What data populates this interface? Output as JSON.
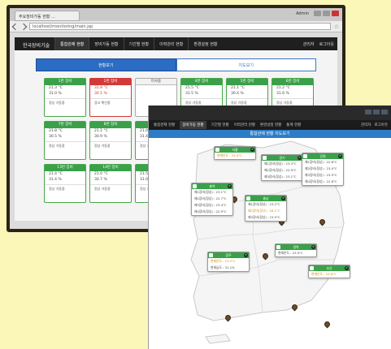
{
  "back_screen": {
    "browser": {
      "tab_title": "주요장비가동 현황 …",
      "url": "localhost/monitoring/main.jsp",
      "window_label": "Admin"
    },
    "navbar": {
      "brand": "한국장비기술",
      "items": [
        "통합관제 현황",
        "장비가동 현황",
        "기간별 현황",
        "이력관리 현황",
        "환경설정 현황"
      ],
      "active_index": 0,
      "right_items": [
        "관리자",
        "로그아웃"
      ]
    },
    "switch": {
      "active": "현황보기",
      "inactive": "지도보기"
    },
    "cards": [
      {
        "title": "1번 장비",
        "l1": "21.3 °C",
        "l2": "31.0 %",
        "footer": "정상 가동중",
        "status": "normal"
      },
      {
        "title": "2번 장비",
        "l1": "31.8 °C",
        "l2": "30.1 %",
        "footer": "경고 확인중",
        "status": "alert"
      },
      {
        "title": "미사용",
        "l1": "",
        "l2": "",
        "footer": "",
        "status": "blank"
      },
      {
        "title": "4번 장비",
        "l1": "21.5 °C",
        "l2": "31.5 %",
        "footer": "정상 가동중",
        "status": "normal"
      },
      {
        "title": "5번 장비",
        "l1": "21.1 °C",
        "l2": "30.4 %",
        "footer": "정상 가동중",
        "status": "normal"
      },
      {
        "title": "6번 장비",
        "l1": "21.2 °C",
        "l2": "31.6 %",
        "footer": "정상 가동중",
        "status": "normal"
      },
      {
        "title": "7번 장비",
        "l1": "21.8 °C",
        "l2": "30.5 %",
        "footer": "정상 가동중",
        "status": "normal"
      },
      {
        "title": "8번 장비",
        "l1": "21.1 °C",
        "l2": "30.9 %",
        "footer": "정상 가동중",
        "status": "normal"
      },
      {
        "title": "9번 장비",
        "l1": "21.0 °C",
        "l2": "31.4 %",
        "footer": "정상 가동중",
        "status": "normal"
      },
      {
        "title": "10번 장비",
        "l1": "21.4 °C",
        "l2": "31.1 %",
        "footer": "정상 가동중",
        "status": "normal"
      },
      {
        "title": "11번 장비",
        "l1": "21.6 °C",
        "l2": "30.8 %",
        "footer": "정상 가동중",
        "status": "normal"
      },
      {
        "title": "12번 장비",
        "l1": "21.3 °C",
        "l2": "31.2 %",
        "footer": "정상 가동중",
        "status": "normal"
      },
      {
        "title": "13번 장비",
        "l1": "21.4 °C",
        "l2": "31.4 %",
        "footer": "정상 가동중",
        "status": "normal"
      },
      {
        "title": "14번 장비",
        "l1": "21.0 °C",
        "l2": "30.7 %",
        "footer": "정상 가동중",
        "status": "normal"
      },
      {
        "title": "15번 장비",
        "l1": "21.5 °C",
        "l2": "31.0 %",
        "footer": "정상 가동중",
        "status": "normal"
      },
      {
        "title": "16번 장비",
        "l1": "21.2 °C",
        "l2": "31.3 %",
        "footer": "정상 가동중",
        "status": "normal"
      }
    ]
  },
  "front_screen": {
    "navbar": {
      "items": [
        "통합관제 현황",
        "장비가동 현황",
        "기간별 현황",
        "이력관리 현황",
        "환경설정 현황",
        "통계 현황"
      ],
      "active_index": 1,
      "right_items": [
        "관리자",
        "로그아웃"
      ]
    },
    "title": "통합관제 현황 지도보기",
    "map_cards": [
      {
        "title": "서울",
        "lines": [
          "현재온도 : 23.4°C"
        ],
        "warn": [
          0
        ]
      },
      {
        "title": "경기",
        "lines": [
          "제1장비(정상) : 23.3°C",
          "제2장비(정상) : 22.9°C",
          "제3장비(정상) : 23.1°C"
        ],
        "warn": []
      },
      {
        "title": "강원",
        "lines": [
          "제1장비(정상) : 22.6°C",
          "제2장비(정상) : 23.0°C",
          "제3장비(정상) : 23.5°C",
          "제4장비(정상) : 22.8°C"
        ],
        "warn": []
      },
      {
        "title": "충북",
        "lines": [
          "제1장비(정상) : 23.1°C",
          "제2장비(정상) : 22.7°C",
          "제3장비(정상) : 23.4°C",
          "제4장비(정상) : 22.9°C"
        ],
        "warn": []
      },
      {
        "title": "충남",
        "lines": [
          "제1장비(정상) : 23.2°C",
          "제2장비(경고) : 28.1°C",
          "제3장비(정상) : 23.0°C"
        ],
        "warn": [
          1
        ]
      },
      {
        "title": "경북",
        "lines": [
          "현재온도 : 23.0°C"
        ],
        "warn": []
      },
      {
        "title": "광주",
        "lines": [
          "현재온도 : 23.2°C",
          "현재습도 : 31.1%"
        ],
        "warn": [
          0
        ]
      },
      {
        "title": "부산",
        "lines": [
          "현재온도 : 23.6°C"
        ],
        "warn": [
          0
        ]
      }
    ]
  },
  "colors": {
    "page_background": "#fbf7b9",
    "status_normal": "#3aa04a",
    "status_alert": "#d23a3a",
    "accent_blue": "#2b6cc4"
  },
  "icons": [
    "back-arrow-icon",
    "forward-arrow-icon",
    "star-icon",
    "close-icon",
    "map-pin-icon"
  ]
}
